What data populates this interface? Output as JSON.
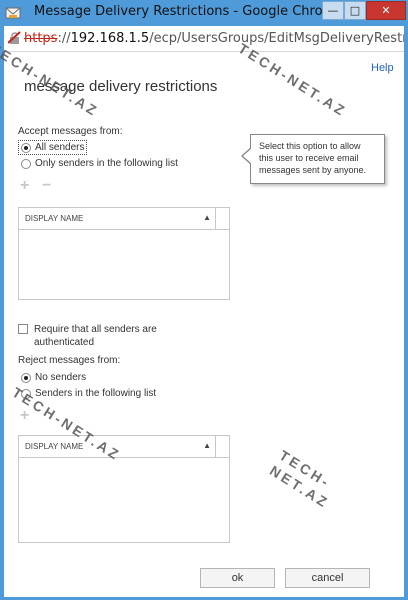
{
  "window": {
    "title": "Message Delivery Restrictions - Google Chrome",
    "minimize_glyph": "—",
    "maximize_glyph": "□",
    "close_glyph": "✕"
  },
  "address": {
    "scheme": "https",
    "rest_prefix": "://",
    "host": "192.168.1.5",
    "path": "/ecp/UsersGroups/EditMsgDeliveryRestrictions"
  },
  "page": {
    "help": "Help",
    "title": "message delivery restrictions"
  },
  "accept": {
    "label": "Accept messages from:",
    "option_all": "All senders",
    "option_list": "Only senders in the following list",
    "selected": "All senders",
    "add_glyph": "+",
    "remove_glyph": "−",
    "list_header": "DISPLAY NAME",
    "sort_glyph": "▲"
  },
  "callout": {
    "text": "Select this option to allow this user to receive email messages sent by anyone."
  },
  "auth": {
    "label": "Require that all senders are authenticated",
    "checked": false
  },
  "reject": {
    "label": "Reject messages from:",
    "option_none": "No senders",
    "option_list": "Senders in the following list",
    "selected": "No senders",
    "add_glyph": "+",
    "list_header": "DISPLAY NAME",
    "sort_glyph": "▲"
  },
  "buttons": {
    "ok": "ok",
    "cancel": "cancel"
  },
  "watermarks": [
    "TECH-NET.AZ",
    "TECH-NET.AZ",
    "TECH-NET.AZ",
    "TECH-NET.AZ"
  ],
  "colors": {
    "titlebar": "#4f9ad9",
    "close_button": "#c7372f",
    "link": "#1f63b8",
    "https_strike": "#c4241b"
  }
}
